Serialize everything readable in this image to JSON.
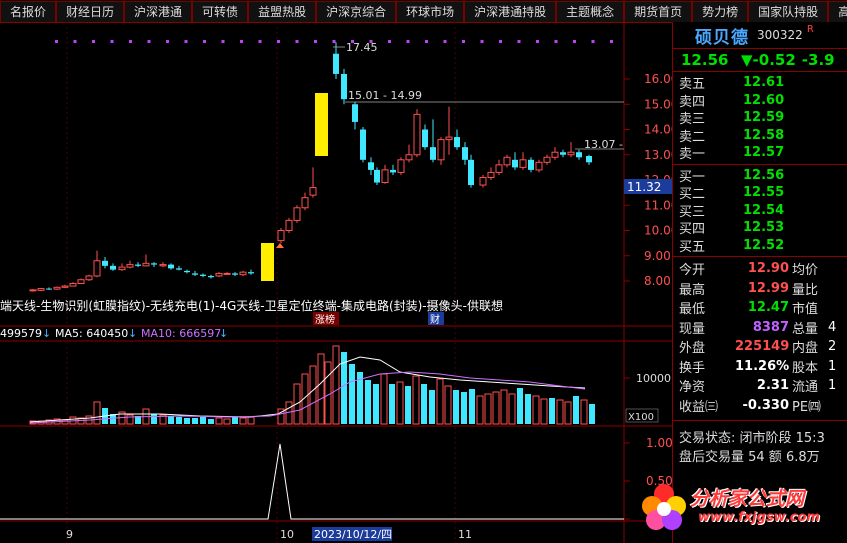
{
  "tabs": [
    "名报价",
    "财经日历",
    "沪深港通",
    "可转债",
    "益盟热股",
    "沪深京综合",
    "环球市场",
    "沪深港通持股",
    "主题概念",
    "期货首页",
    "势力榜",
    "国家队持股",
    "高转送"
  ],
  "stock": {
    "name": "硕贝德",
    "code": "300322",
    "flag": "R",
    "price": "12.56",
    "change": "▼-0.52",
    "change_pct": "-3.9"
  },
  "orderbook": [
    {
      "label": "卖五",
      "price": "12.61"
    },
    {
      "label": "卖四",
      "price": "12.60"
    },
    {
      "label": "卖三",
      "price": "12.59"
    },
    {
      "label": "卖二",
      "price": "12.58"
    },
    {
      "label": "卖一",
      "price": "12.57"
    },
    {
      "label": "买一",
      "price": "12.56"
    },
    {
      "label": "买二",
      "price": "12.55"
    },
    {
      "label": "买三",
      "price": "12.54"
    },
    {
      "label": "买四",
      "price": "12.53"
    },
    {
      "label": "买五",
      "price": "12.52"
    }
  ],
  "stats": [
    {
      "k": "今开",
      "v": "12.90",
      "k2": "均价",
      "color": "#ff5050"
    },
    {
      "k": "最高",
      "v": "12.99",
      "k2": "量比",
      "color": "#ff5050"
    },
    {
      "k": "最低",
      "v": "12.47",
      "k2": "市值",
      "color": "#00e000"
    },
    {
      "k": "现量",
      "v": "8387",
      "k2": "总量",
      "color": "#c060ff",
      "v2": "4"
    },
    {
      "k": "外盘",
      "v": "225149",
      "k2": "内盘",
      "color": "#ff5050",
      "v2": "2"
    },
    {
      "k": "换手",
      "v": "11.26%",
      "k2": "股本",
      "color": "#ffffff",
      "v2": "1"
    },
    {
      "k": "净资",
      "v": "2.31",
      "k2": "流通",
      "color": "#ffffff",
      "v2": "1"
    },
    {
      "k": "收益㈢",
      "v": "-0.330",
      "k2": "PE㈣",
      "color": "#ffffff"
    }
  ],
  "state": {
    "line1": "交易状态: 闭市阶段 15:3",
    "line2": "盘后交易量 54 额 6.8万"
  },
  "chart": {
    "y_ticks": [
      "16.00",
      "15.00",
      "14.00",
      "13.00",
      "12.00",
      "11.00",
      "10.00",
      "9.00",
      "8.00"
    ],
    "current_price": "11.32",
    "annotations": {
      "high": "17.45",
      "range1": "15.01 - 14.99",
      "range2": "13.07 -"
    },
    "concept_line": "端天线-生物识别(虹膜指纹)-无线充电(1)-4G天线-卫星定位终端-集成电路(封装)-摄像头-供联想",
    "tag_limit": "涨榜",
    "tag_cai": "财",
    "vol_labels": {
      "vol": "499579",
      "ma5": "MA5: 640450",
      "ma10": "MA10: 666597"
    },
    "vol_tick": "10000",
    "vol_unit": "X100",
    "ind_ticks": [
      "1.00",
      "0.50",
      "0.00"
    ],
    "x_labels": {
      "m9": "9",
      "m10": "10",
      "date": "2023/10/12/四",
      "m11": "11"
    }
  },
  "watermark": {
    "text": "分析家公式网",
    "url": "www.fxjgsw.com"
  }
}
